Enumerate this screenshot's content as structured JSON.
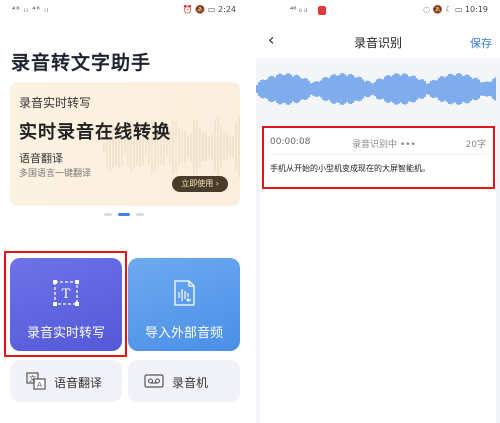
{
  "left": {
    "status": {
      "signals": "⁴⁶ ᵢₗ ⁴⁶ ᵢₗ",
      "time": "2:24"
    },
    "app_title": "录音转文字助手",
    "banner": {
      "subtitle": "录音实时转写",
      "headline": "实时录音在线转换",
      "line3": "语音翻译",
      "line4": "多国语言一键翻译",
      "button_label": "立即使用 ›"
    },
    "tiles": [
      {
        "label": "录音实时转写",
        "icon": "text-box-icon"
      },
      {
        "label": "导入外部音频",
        "icon": "audio-import-icon"
      },
      {
        "label": "语音翻译",
        "icon": "translate-icon"
      },
      {
        "label": "录音机",
        "icon": "recorder-icon"
      }
    ],
    "accent": "#e0151a"
  },
  "right": {
    "status": {
      "signals": "⁴⁶ ᵢₗ ᵢₗ",
      "time": "10:19"
    },
    "nav": {
      "back": "‹",
      "title": "录音识别",
      "save": "保存"
    },
    "record": {
      "time": "00:00:08",
      "status": "录音识别中 •••",
      "count": "20字",
      "text": "手机从开始的小型机变成现在的大屏智能机。"
    },
    "colors": {
      "wave": "#3f85e6",
      "link": "#2f7de1"
    }
  }
}
